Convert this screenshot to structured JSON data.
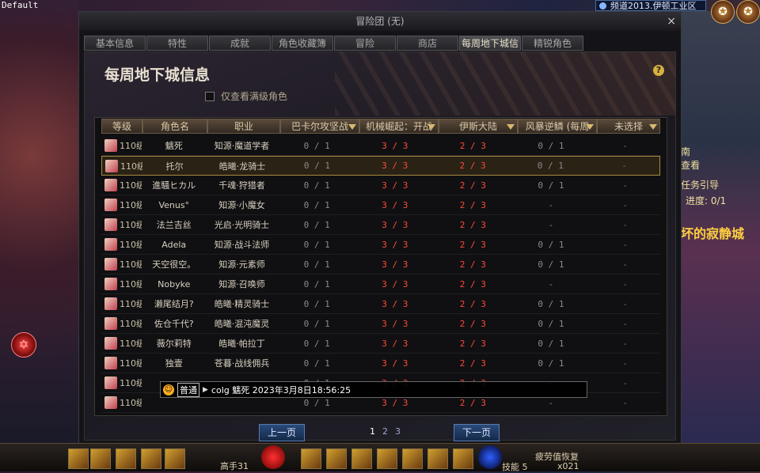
{
  "overlay": {
    "default_label": "Default"
  },
  "channel": {
    "text": "频道2013.伊顿工业区"
  },
  "side": {
    "lines": [
      "南",
      "查看",
      "任务引导",
      "进度: 0/1",
      "坏的寂静城"
    ],
    "bottom_label": "疲劳值恢复"
  },
  "window": {
    "title": "冒险团 (无)",
    "close": "×",
    "tabs": [
      "基本信息",
      "特性",
      "成就",
      "角色收藏簿",
      "冒险",
      "商店",
      "每周地下城信息",
      "精锐角色"
    ],
    "active_tab": 6,
    "heading": "每周地下城信息",
    "help": "?",
    "filter_label": "仅查看满级角色"
  },
  "table": {
    "headers": [
      "等级",
      "角色名",
      "职业",
      "巴卡尔攻坚战",
      "机械崛起：开战",
      "伊斯大陆",
      "风暴逆鳞 (每周",
      "未选择"
    ],
    "rows": [
      {
        "lv": "110级",
        "name": "魑死",
        "job": "知源·魔道学者",
        "d1": "0 / 1",
        "d2": "3 / 3",
        "d3": "2 / 3",
        "d4": "0 / 1",
        "d5": "-"
      },
      {
        "lv": "110级",
        "name": "托尔",
        "job": "皓曦·龙骑士",
        "d1": "0 / 1",
        "d2": "3 / 3",
        "d3": "2 / 3",
        "d4": "0 / 1",
        "d5": "-",
        "selected": true
      },
      {
        "lv": "110级",
        "name": "進騒ヒカル",
        "job": "千魂·狩猎者",
        "d1": "0 / 1",
        "d2": "3 / 3",
        "d3": "2 / 3",
        "d4": "0 / 1",
        "d5": "-"
      },
      {
        "lv": "110级",
        "name": "Venus°",
        "job": "知源·小魔女",
        "d1": "0 / 1",
        "d2": "3 / 3",
        "d3": "2 / 3",
        "d4": "-",
        "d5": "-"
      },
      {
        "lv": "110级",
        "name": "法兰吉丝",
        "job": "光启·光明骑士",
        "d1": "0 / 1",
        "d2": "3 / 3",
        "d3": "2 / 3",
        "d4": "-",
        "d5": "-"
      },
      {
        "lv": "110级",
        "name": "Adela",
        "job": "知源·战斗法师",
        "d1": "0 / 1",
        "d2": "3 / 3",
        "d3": "2 / 3",
        "d4": "0 / 1",
        "d5": "-"
      },
      {
        "lv": "110级",
        "name": "天空很空。",
        "job": "知源·元素师",
        "d1": "0 / 1",
        "d2": "3 / 3",
        "d3": "2 / 3",
        "d4": "0 / 1",
        "d5": "-"
      },
      {
        "lv": "110级",
        "name": "Nobyke",
        "job": "知源·召唤师",
        "d1": "0 / 1",
        "d2": "3 / 3",
        "d3": "2 / 3",
        "d4": "-",
        "d5": "-"
      },
      {
        "lv": "110级",
        "name": "濑尾结月?",
        "job": "皓曦·精灵骑士",
        "d1": "0 / 1",
        "d2": "3 / 3",
        "d3": "2 / 3",
        "d4": "0 / 1",
        "d5": "-"
      },
      {
        "lv": "110级",
        "name": "佐仓千代?",
        "job": "皓曦·混沌魔灵",
        "d1": "0 / 1",
        "d2": "3 / 3",
        "d3": "2 / 3",
        "d4": "0 / 1",
        "d5": "-"
      },
      {
        "lv": "110级",
        "name": "薇尔莉特",
        "job": "皓曦·帕拉丁",
        "d1": "0 / 1",
        "d2": "3 / 3",
        "d3": "2 / 3",
        "d4": "0 / 1",
        "d5": "-"
      },
      {
        "lv": "110级",
        "name": "独壹",
        "job": "苍暮·战线佣兵",
        "d1": "0 / 1",
        "d2": "3 / 3",
        "d3": "2 / 3",
        "d4": "0 / 1",
        "d5": "-"
      },
      {
        "lv": "110级",
        "name": "",
        "job": "",
        "d1": "0 / 1",
        "d2": "3 / 3",
        "d3": "2 / 3",
        "d4": "-",
        "d5": "-"
      },
      {
        "lv": "110级",
        "name": "",
        "job": "",
        "d1": "0 / 1",
        "d2": "3 / 3",
        "d3": "2 / 3",
        "d4": "-",
        "d5": "-"
      }
    ]
  },
  "pager": {
    "prev": "上一页",
    "next": "下一页",
    "pages": [
      "1",
      "2",
      "3"
    ],
    "current": 0
  },
  "chat": {
    "mode": "普通",
    "text": "colg 魑死 2023年3月8日18:56:25"
  },
  "hud": {
    "level_label": "高手31",
    "skill_label": "技能",
    "skill_value": "5",
    "gold": "x021"
  },
  "colors": {
    "done": "#ff4a3a",
    "pending": "#8a8a8a",
    "accent": "#a88a40"
  }
}
